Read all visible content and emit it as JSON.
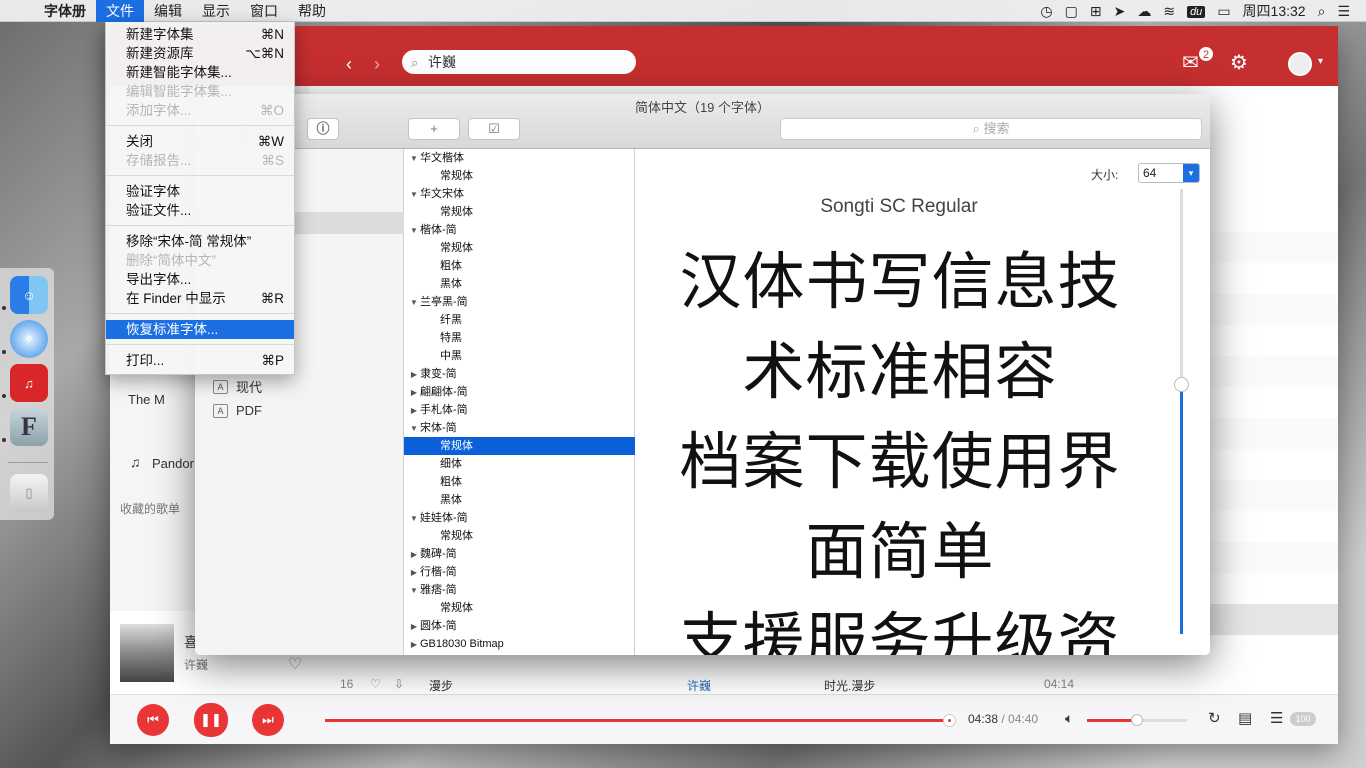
{
  "menubar": {
    "app_name": "字体册",
    "menus": [
      "文件",
      "编辑",
      "显示",
      "窗口",
      "帮助"
    ],
    "clock": "周四13:32",
    "status_du": "du"
  },
  "file_menu": {
    "items": [
      {
        "label": "新建字体集",
        "shortcut": "⌘N"
      },
      {
        "label": "新建资源库",
        "shortcut": "⌥⌘N"
      },
      {
        "label": "新建智能字体集...",
        "shortcut": ""
      },
      {
        "label": "编辑智能字体集...",
        "shortcut": ""
      },
      {
        "label": "添加字体...",
        "shortcut": "⌘O"
      },
      {
        "label": "关闭",
        "shortcut": "⌘W"
      },
      {
        "label": "存储报告...",
        "shortcut": "⌘S"
      },
      {
        "label": "验证字体",
        "shortcut": ""
      },
      {
        "label": "验证文件...",
        "shortcut": ""
      },
      {
        "label": "移除“宋体-简 常规体”",
        "shortcut": ""
      },
      {
        "label": "删除“简体中文”",
        "shortcut": ""
      },
      {
        "label": "导出字体...",
        "shortcut": ""
      },
      {
        "label": "在 Finder 中显示",
        "shortcut": "⌘R"
      },
      {
        "label": "恢复标准字体...",
        "shortcut": ""
      },
      {
        "label": "打印...",
        "shortcut": "⌘P"
      }
    ]
  },
  "music": {
    "search_value": "许巍",
    "mail_badge": "2",
    "sidebar_items": [
      "The M",
      "Pandor"
    ],
    "fav_label": "收藏的歌单",
    "song": {
      "no": "16",
      "title": "漫步",
      "artist": "许巍",
      "album": "时光.漫步",
      "duration": "04:14"
    },
    "now_playing": {
      "title": "喜",
      "artist": "许巍"
    },
    "time_current": "04:38",
    "time_total": "/ 04:40",
    "progress": 0.99,
    "volume": 0.5,
    "playlist_count": "100"
  },
  "fontbook": {
    "title": "简体中文（19 个字体）",
    "search_placeholder": "搜索",
    "collections": [
      {
        "icon": "A",
        "label": "现代"
      },
      {
        "icon": "A",
        "label": "PDF"
      }
    ],
    "families": [
      {
        "name": "华文楷体",
        "open": true,
        "faces": [
          "常规体"
        ]
      },
      {
        "name": "华文宋体",
        "open": true,
        "faces": [
          "常规体"
        ]
      },
      {
        "name": "楷体-简",
        "open": true,
        "faces": [
          "常规体",
          "粗体",
          "黑体"
        ]
      },
      {
        "name": "兰亭黑-简",
        "open": true,
        "faces": [
          "纤黑",
          "特黑",
          "中黑"
        ]
      },
      {
        "name": "隶变-简",
        "open": false,
        "faces": []
      },
      {
        "name": "翩翩体-简",
        "open": false,
        "faces": []
      },
      {
        "name": "手札体-简",
        "open": false,
        "faces": []
      },
      {
        "name": "宋体-简",
        "open": true,
        "faces": [
          "常规体",
          "细体",
          "粗体",
          "黑体"
        ]
      },
      {
        "name": "娃娃体-简",
        "open": true,
        "faces": [
          "常规体"
        ]
      },
      {
        "name": "魏碑-简",
        "open": false,
        "faces": []
      },
      {
        "name": "行楷-简",
        "open": false,
        "faces": []
      },
      {
        "name": "雅痞-简",
        "open": true,
        "faces": [
          "常规体"
        ]
      },
      {
        "name": "圆体-简",
        "open": false,
        "faces": []
      },
      {
        "name": "GB18030 Bitmap",
        "open": false,
        "faces": []
      }
    ],
    "selected_face": "宋体-简/常规体",
    "size_label": "大小:",
    "size_value": "64",
    "preview_font_name": "Songti SC Regular",
    "preview_lines": [
      "汉体书写信息技",
      "术标准相容",
      "档案下载使用界",
      "面简单",
      "支援服务升级资"
    ]
  }
}
